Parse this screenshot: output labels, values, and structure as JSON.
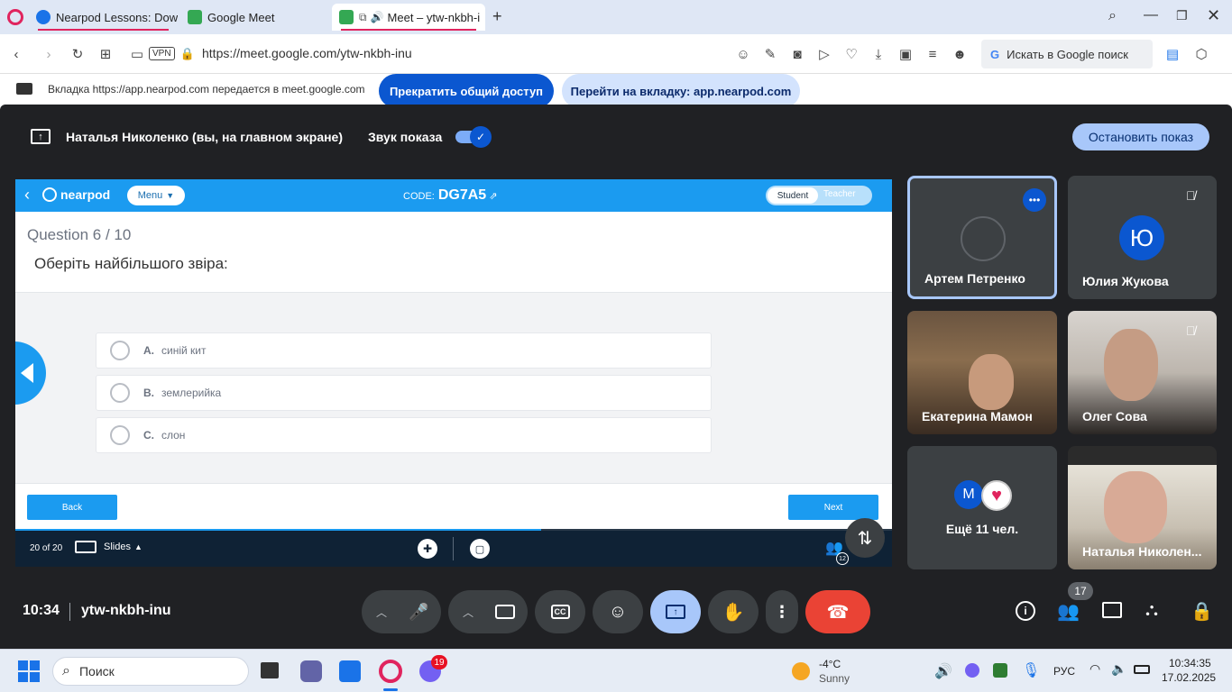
{
  "tabs": [
    {
      "label": "Nearpod Lessons: Downlo",
      "color": "#1a73e8"
    },
    {
      "label": "Google Meet",
      "color": "#34a853"
    },
    {
      "label": "Meet – ytw-nkbh-i",
      "color": "#34a853"
    }
  ],
  "address": {
    "vpn": "VPN",
    "url": "https://meet.google.com/ytw-nkbh-inu",
    "search_label": "Искать в Google поиск"
  },
  "share_banner": {
    "message": "Вкладка https://app.nearpod.com передается в meet.google.com",
    "stop_button": "Прекратить общий доступ",
    "goto_button": "Перейти на вкладку: app.nearpod.com"
  },
  "present": {
    "presenter": "Наталья Николенко (вы, на главном экране)",
    "sound_label": "Звук показа",
    "stop_button": "Остановить показ"
  },
  "nearpod": {
    "menu_label": "Menu",
    "code_label": "CODE:",
    "code": "DG7A5",
    "student_label": "Student",
    "teacher_label": "Teacher",
    "question_counter": "Question 6 / 10",
    "question": "Оберіть найбільшого звіра:",
    "options": [
      {
        "letter": "A.",
        "text": "синій кит"
      },
      {
        "letter": "B.",
        "text": "землерийка"
      },
      {
        "letter": "C.",
        "text": "слон"
      }
    ],
    "back_label": "Back",
    "next_label": "Next",
    "slides_counter": "20 of 20",
    "slides_label": "Slides",
    "participants_badge": "12",
    "progress": 0.6
  },
  "participants": [
    {
      "name": "Артем Петренко",
      "kind": "avatar-empty"
    },
    {
      "name": "Юлия Жукова",
      "kind": "initial",
      "initial": "Ю",
      "color": "#0b57d0"
    },
    {
      "name": "Екатерина Мамон",
      "kind": "video"
    },
    {
      "name": "Олег Сова",
      "kind": "video"
    },
    {
      "name": "Ещё 11 чел.",
      "kind": "more",
      "initial": "М"
    },
    {
      "name": "Наталья Николен...",
      "kind": "video"
    }
  ],
  "meeting": {
    "time": "10:34",
    "code": "ytw-nkbh-inu",
    "people_count": "17"
  },
  "taskbar": {
    "search_label": "Поиск",
    "viber_badge": "19",
    "weather_temp": "-4°C",
    "weather_text": "Sunny",
    "lang": "РУС",
    "clock_time": "10:34:35",
    "clock_date": "17.02.2025"
  },
  "colors": {
    "accent_blue": "#0b57d0",
    "end_call_red": "#ea4335",
    "nearpod_blue": "#1b9bf0",
    "meet_bg": "#202124"
  }
}
